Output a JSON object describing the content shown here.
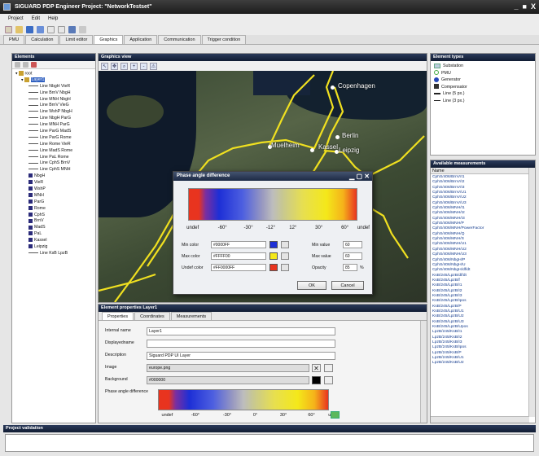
{
  "window": {
    "title": "SIGUARD PDP Engineer Project:  \"NetworkTestset\"",
    "controls": [
      "_",
      "■",
      "X"
    ]
  },
  "menu": [
    "Project",
    "Edit",
    "Help"
  ],
  "tabs": [
    "PMU",
    "Calculation",
    "Limit editor",
    "Graphics",
    "Application",
    "Communication",
    "Trigger condition"
  ],
  "active_tab": "Graphics",
  "elements_panel": {
    "title": "Elements",
    "tree": [
      "root",
      "Layer1"
    ],
    "lines": [
      "Line NbgH VieR",
      "Line BrnV NbgH",
      "Line MNH NbgH",
      "Line BrnV VieG",
      "Line WshP NbgH",
      "Line NbgH ParG",
      "Line MNH ParG",
      "Line ParG MadS",
      "Line ParG Rome",
      "Line Rome VieR",
      "Line MadS Rome",
      "Line PaL Rome",
      "Line CphS BrnV",
      "Line CphS MNH"
    ],
    "nodes": [
      "NbgH",
      "VieR",
      "WshP",
      "MNH",
      "ParG",
      "Rome",
      "CphS",
      "BrnV",
      "MadS",
      "PaL",
      "Kassel",
      "Leipzig"
    ],
    "last": "Line KsB LpzB"
  },
  "graphics_panel": {
    "title": "Graphics view",
    "tools": [
      "↖",
      "✥",
      "⌕",
      "+",
      "-",
      "⚠"
    ],
    "cities": [
      "Copenhagen",
      "Berlin",
      "Muelheim",
      "Kassel",
      "Leipzig"
    ]
  },
  "dialog": {
    "title": "Phase angle difference",
    "ticks": [
      "undef",
      "-60°",
      "-30°",
      "-12°",
      "12°",
      "30°",
      "60°",
      "undef"
    ],
    "min_color_label": "Min color",
    "min_color": "#0000FF",
    "max_color_label": "Max color",
    "max_color": "#FFFF00",
    "undef_color_label": "Undef color",
    "undef_color": "#FF0000FF",
    "min_value_label": "Min value",
    "min_value": "60",
    "max_value_label": "Max value",
    "max_value": "60",
    "opacity_label": "Opacity",
    "opacity": "85",
    "opacity_unit": "%",
    "ok": "OK",
    "cancel": "Cancel",
    "colors": {
      "min": "#1d2fd6",
      "max": "#f4e81a",
      "undef": "#e8341f"
    }
  },
  "properties_panel": {
    "title": "Element properties  Layer1",
    "tabs": [
      "Properties",
      "Coordinates",
      "Measurements"
    ],
    "internal_name_label": "Internal name",
    "internal_name": "Layer1",
    "display_name_label": "Displayedname",
    "display_name": "",
    "description_label": "Description",
    "description": "Siguard PDP UI Layer",
    "image_label": "Image",
    "image": "europe.png",
    "background_label": "Background",
    "background": "#000000",
    "phase_label": "Phase angle difference",
    "ticks": [
      "undef",
      "-60°",
      "-30°",
      "0°",
      "30°",
      "60°",
      "undef"
    ]
  },
  "types_panel": {
    "title": "Element types",
    "items": [
      "Substation",
      "PMU",
      "Generator",
      "Compensator",
      "Line (5 px.)",
      "Line (3 px.)"
    ]
  },
  "measurements_panel": {
    "title": "Available measurements",
    "column": "Name",
    "items": [
      "CphS/406/BrnV/I1",
      "CphS/406/BrnV/I2",
      "CphS/406/BrnV/I3",
      "CphS/406/BrnV/U1",
      "CphS/406/BrnV/U2",
      "CphS/406/BrnV/U3",
      "CphS/406/MNH/I1",
      "CphS/406/MNH/I2",
      "CphS/406/MNH/I3",
      "CphS/406/MNH/P",
      "CphS/406/MNH/PowerFactor",
      "CphS/406/MNH/Q",
      "CphS/406/MNH/S",
      "CphS/406/MNH/U1",
      "CphS/406/MNH/U2",
      "CphS/406/MNH/U3",
      "CphS/406/NbgH/P",
      "CphS/406/NbgH/U",
      "CphS/406/NbgH/df/dt",
      "KsB/245/LpzB/df/dt",
      "KsB/245/LpzB/f",
      "KsB/245/LpzB/I1",
      "KsB/245/LpzB/I2",
      "KsB/245/LpzB/I3",
      "KsB/245/LpzB/Ipos",
      "KsB/245/LpzB/P",
      "KsB/245/LpzB/U1",
      "KsB/245/LpzB/U2",
      "KsB/245/LpzB/U3",
      "KsB/245/LpzB/Upos",
      "LpzB/245/KsB/I1",
      "LpzB/245/KsB/I2",
      "LpzB/245/KsB/I3",
      "LpzB/245/KsB/Ipos",
      "LpzB/245/KsB/P",
      "LpzB/245/KsB/U1",
      "LpzB/245/KsB/U2"
    ]
  },
  "validation": {
    "title": "Project validation"
  }
}
